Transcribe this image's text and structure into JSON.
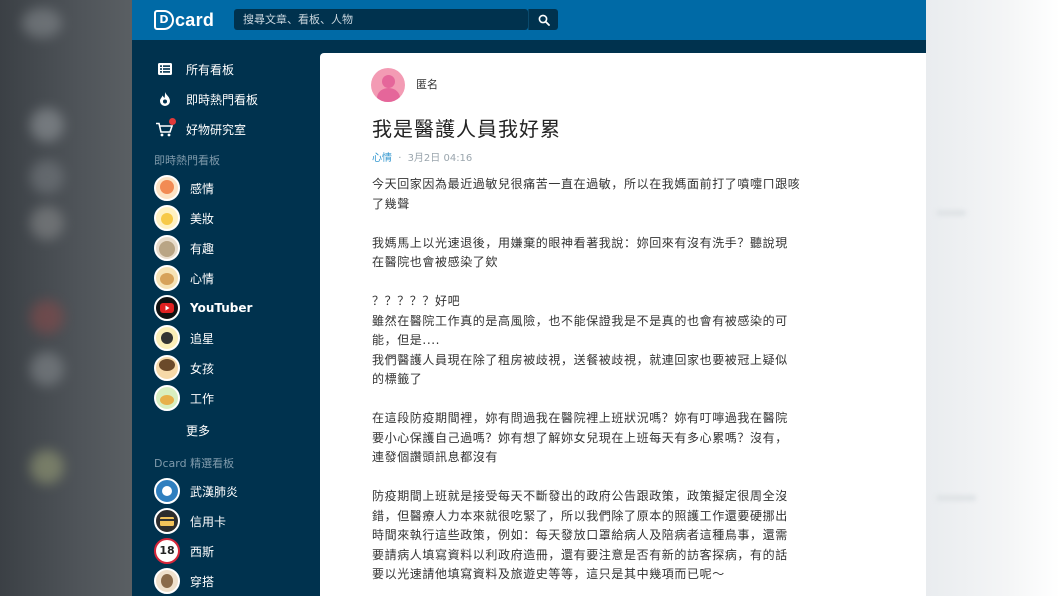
{
  "header": {
    "logo_text": "card",
    "logo_mark": "D",
    "search_placeholder": "搜尋文章、看板、人物"
  },
  "sidebar": {
    "main_items": [
      {
        "label": "所有看板",
        "icon": "list-icon"
      },
      {
        "label": "即時熱門看板",
        "icon": "fire-icon"
      },
      {
        "label": "好物研究室",
        "icon": "cart-icon"
      }
    ],
    "hot_section_title": "即時熱門看板",
    "hot_boards": [
      {
        "label": "感情",
        "icon": "board-love-icon",
        "color": "#f28b54"
      },
      {
        "label": "美妝",
        "icon": "board-makeup-icon",
        "color": "#f7c948"
      },
      {
        "label": "有趣",
        "icon": "board-funny-icon",
        "color": "#c9b79c"
      },
      {
        "label": "心情",
        "icon": "board-mood-icon",
        "color": "#e6c06b"
      },
      {
        "label": "YouTuber",
        "icon": "youtube-icon",
        "color": "#e02020"
      },
      {
        "label": "追星",
        "icon": "board-star-icon",
        "color": "#f5d25a"
      },
      {
        "label": "女孩",
        "icon": "board-girl-icon",
        "color": "#e8a34b"
      },
      {
        "label": "工作",
        "icon": "board-work-icon",
        "color": "#9fcf6a"
      }
    ],
    "more_label": "更多",
    "featured_section_title": "Dcard 精選看板",
    "featured_boards": [
      {
        "label": "武漢肺炎",
        "icon": "board-virus-icon",
        "color": "#2f7fbf"
      },
      {
        "label": "信用卡",
        "icon": "credit-card-icon",
        "color": "#2d2d2d"
      },
      {
        "label": "西斯",
        "icon": "board-18-icon",
        "color": "#d6263a",
        "text": "18"
      },
      {
        "label": "穿搭",
        "icon": "board-outfit-icon",
        "color": "#c7a37a"
      }
    ]
  },
  "post": {
    "author": "匿名",
    "title": "我是醫護人員我好累",
    "forum": "心情",
    "separator": "·",
    "date": "3月2日 04:16",
    "paragraphs": [
      [
        "今天回家因為最近過敏兒很痛苦一直在過敏，所以在我媽面前打了噴嚏ㄇ跟咳",
        "了幾聲"
      ],
      [
        "我媽馬上以光速退後，用嫌棄的眼神看著我說：妳回來有沒有洗手？聽說現",
        "在醫院也會被感染了欸"
      ],
      [
        "？？？？？好吧",
        "雖然在醫院工作真的是高風險，也不能保證我是不是真的也會有被感染的可",
        "能，但是....",
        "我們醫護人員現在除了租房被歧視，送餐被歧視，就連回家也要被冠上疑似",
        "的標籤了"
      ],
      [
        "在這段防疫期間裡，妳有問過我在醫院裡上班狀況嗎？妳有叮嚀過我在醫院",
        "要小心保護自己過嗎？妳有想了解妳女兒現在上班每天有多心累嗎？沒有，",
        "連發個讚頭訊息都沒有"
      ],
      [
        "防疫期間上班就是接受每天不斷發出的政府公告跟政策，政策擬定很周全沒",
        "錯，但醫療人力本來就很吃緊了，所以我們除了原本的照護工作還要硬挪出",
        "時間來執行這些政策，例如：每天發放口罩給病人及陪病者這種鳥事，還需",
        "要請病人填寫資料以利政府造冊，還有要注意是否有新的訪客探病，有的話",
        "要以光速請他填寫資料及旅遊史等等，這只是其中幾項而已呢～"
      ]
    ]
  }
}
